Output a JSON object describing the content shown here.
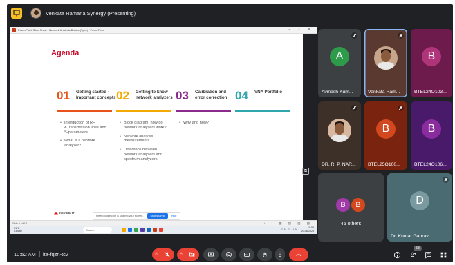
{
  "presenter": {
    "name": "Venkata Ramana Synergy (Presenting)"
  },
  "ppt": {
    "window_title": "PowerPoint Slide Show - Network Analysis Basics (Type) - PowerPoint",
    "controls": "– ▫ ✕",
    "slide_counter": "Slide 1 of 12"
  },
  "slide": {
    "title": "Agenda",
    "brand": "KEYSIGHT",
    "columns": [
      {
        "num": "01",
        "title": "Getting started - Important concepts",
        "color": "#e8531b",
        "bullets": [
          "Interduction of RF &Transmission lines and S-parameters",
          "What is a network analyzer?"
        ]
      },
      {
        "num": "02",
        "title": "Getting to know network analyzers",
        "color": "#f2a900",
        "bullets": [
          "Block diagram: how do network analyzers work?",
          "Network analysis measurements",
          "Difference between network analyzers and spectrum analyzers"
        ]
      },
      {
        "num": "03",
        "title": "Calibration and error correction",
        "color": "#8b2b8c",
        "bullets": [
          "Why and how?"
        ]
      },
      {
        "num": "04",
        "title": "VNA Portfolio",
        "color": "#2fa7ad",
        "bullets": []
      }
    ]
  },
  "share_bar": {
    "text": "meet.google.com is sharing your screen.",
    "stop": "Stop sharing",
    "hide": "Hide"
  },
  "taskbar": {
    "weather_temp": "31°C",
    "weather_desc": "Cloudy",
    "search": "Search",
    "tray": "ENG IN",
    "clock_time": "10:52",
    "clock_date": "20-08-2025"
  },
  "participants": [
    {
      "name": "Avinash Kum...",
      "initial": "A",
      "color": "#2e9b4a",
      "bg": "#3c4043"
    },
    {
      "name": "Venkata Ram...",
      "initial": "",
      "color": "#c7a58a",
      "bg": "#5a3a30"
    },
    {
      "name": "BTEL24O103...",
      "initial": "B",
      "color": "#b0347a",
      "bg": "#6d1b4c"
    },
    {
      "name": "DR. R. P. NAR...",
      "initial": "",
      "color": "#d7b7a0",
      "bg": "#3c3028"
    },
    {
      "name": "BTEL25O100...",
      "initial": "B",
      "color": "#d3481e",
      "bg": "#7a2410"
    },
    {
      "name": "BTEL24O106...",
      "initial": "B",
      "color": "#8a2c9e",
      "bg": "#4a1a6a"
    },
    {
      "name": "45 others",
      "initial": "B",
      "color": "#a03aa8",
      "bg": "#3c4043"
    },
    {
      "name": "Dr. Kumar Gaurav",
      "initial": "D",
      "color": "#7a9aa0",
      "bg": "#4b6b72"
    }
  ],
  "others_initials": [
    "B",
    "B"
  ],
  "others_colors": [
    "#a03aa8",
    "#d3481e"
  ],
  "bottom": {
    "time": "10:52 AM",
    "code": "ita-fqzn-tcv",
    "participant_count": "53"
  },
  "colors": {
    "end_call": "#ea4335",
    "muted": "#ea4335",
    "meet_bg": "#202124"
  },
  "icons": [
    "present-icon",
    "mic-off-icon",
    "camera-off-icon",
    "present-screen-icon",
    "emoji-icon",
    "captions-icon",
    "raise-hand-icon",
    "more-options-icon",
    "end-call-icon",
    "info-icon",
    "people-icon",
    "chat-icon",
    "activities-icon"
  ]
}
